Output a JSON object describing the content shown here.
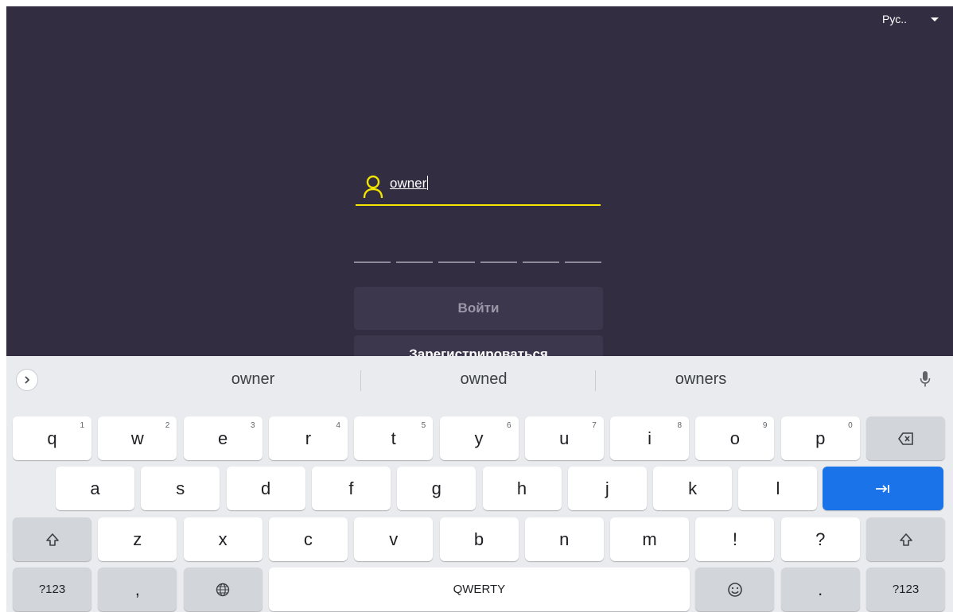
{
  "app": {
    "language": "Рус..",
    "login_value": "owner",
    "pin_slots": 6,
    "login_button": "Войти",
    "register_button": "Зарегистрироваться"
  },
  "keyboard": {
    "suggestions": [
      "owner",
      "owned",
      "owners"
    ],
    "row1": [
      {
        "label": "q",
        "hint": "1"
      },
      {
        "label": "w",
        "hint": "2"
      },
      {
        "label": "e",
        "hint": "3"
      },
      {
        "label": "r",
        "hint": "4"
      },
      {
        "label": "t",
        "hint": "5"
      },
      {
        "label": "y",
        "hint": "6"
      },
      {
        "label": "u",
        "hint": "7"
      },
      {
        "label": "i",
        "hint": "8"
      },
      {
        "label": "o",
        "hint": "9"
      },
      {
        "label": "p",
        "hint": "0"
      }
    ],
    "row2": [
      "a",
      "s",
      "d",
      "f",
      "g",
      "h",
      "j",
      "k",
      "l"
    ],
    "row3": [
      "z",
      "x",
      "c",
      "v",
      "b",
      "n",
      "m",
      "!",
      "?"
    ],
    "symbols_key": "?123",
    "comma_key": ",",
    "space_key": "QWERTY",
    "period_key": "."
  },
  "colors": {
    "app_background": "#322d41",
    "accent_yellow": "#f2e600",
    "keyboard_background": "#e9ebee",
    "enter_key": "#1a73e8"
  }
}
